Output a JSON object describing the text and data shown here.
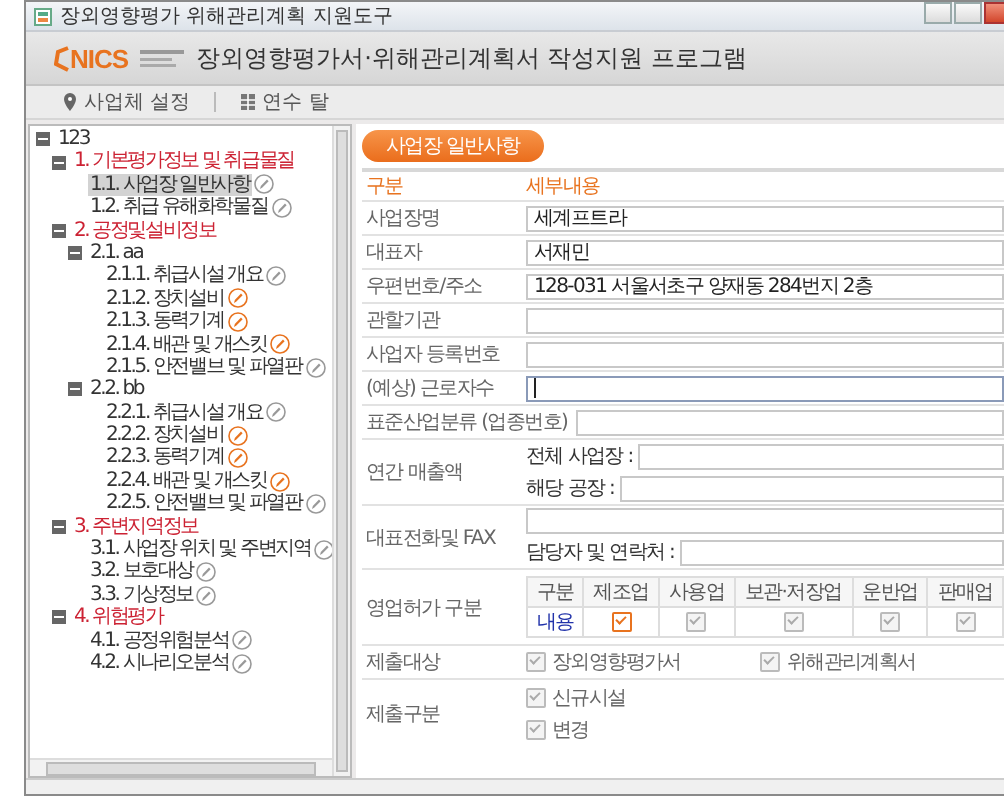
{
  "window": {
    "title": "장외영향평가 위해관리계획 지원도구"
  },
  "header": {
    "logo": "NICS",
    "title": "장외영향평가서·위해관리계획서 작성지원 프로그램"
  },
  "toolbar": [
    {
      "label": "사업체 설정"
    },
    {
      "label": "연수 탈"
    }
  ],
  "tree": {
    "label": "123",
    "expanded": true,
    "children": [
      {
        "label": "1. 기본평가정보 및 취급물질",
        "expanded": true,
        "children": [
          {
            "label": "1.1. 사업장 일반사항",
            "selected": true,
            "flagged": false
          },
          {
            "label": "1.2. 취급 유해화학물질",
            "selected": false,
            "flagged": false
          }
        ]
      },
      {
        "label": "2. 공정및설비정보",
        "expanded": true,
        "children": [
          {
            "label": "2.1. aa",
            "expanded": true,
            "children": [
              {
                "label": "2.1.1. 취급시설 개요",
                "selected": false,
                "flagged": false
              },
              {
                "label": "2.1.2. 장치설비",
                "selected": false,
                "flagged": true
              },
              {
                "label": "2.1.3. 동력기계",
                "selected": false,
                "flagged": true
              },
              {
                "label": "2.1.4. 배관 및 개스킷",
                "selected": false,
                "flagged": true
              },
              {
                "label": "2.1.5. 안전밸브 및 파열판",
                "selected": false,
                "flagged": false
              }
            ]
          },
          {
            "label": "2.2. bb",
            "expanded": true,
            "children": [
              {
                "label": "2.2.1. 취급시설 개요",
                "selected": false,
                "flagged": false
              },
              {
                "label": "2.2.2. 장치설비",
                "selected": false,
                "flagged": true
              },
              {
                "label": "2.2.3. 동력기계",
                "selected": false,
                "flagged": true
              },
              {
                "label": "2.2.4. 배관 및 개스킷",
                "selected": false,
                "flagged": true
              },
              {
                "label": "2.2.5. 안전밸브 및 파열판",
                "selected": false,
                "flagged": false
              }
            ]
          }
        ]
      },
      {
        "label": "3. 주변지역정보",
        "expanded": true,
        "children": [
          {
            "label": "3.1. 사업장 위치 및 주변지역",
            "selected": false,
            "flagged": false
          },
          {
            "label": "3.2. 보호대상",
            "selected": false,
            "flagged": false
          },
          {
            "label": "3.3. 기상정보",
            "selected": false,
            "flagged": false
          }
        ]
      },
      {
        "label": "4. 위험평가",
        "expanded": true,
        "children": [
          {
            "label": "4.1. 공정위험분석",
            "selected": false,
            "flagged": false
          },
          {
            "label": "4.2. 시나리오분석",
            "selected": false,
            "flagged": false
          }
        ]
      }
    ]
  },
  "form": {
    "section_button": "사업장 일반사항",
    "columns": [
      "구분",
      "세부내용"
    ],
    "rows": [
      {
        "kind": "text",
        "label": "사업장명",
        "value": "세계프트라",
        "focused": false
      },
      {
        "kind": "text",
        "label": "대표자",
        "value": "서재민",
        "focused": false
      },
      {
        "kind": "text",
        "label": "우편번호/주소",
        "value": "128-031 서울서초구 양재동 284번지 2층",
        "focused": false
      },
      {
        "kind": "text",
        "label": "관할기관",
        "focused": false
      },
      {
        "kind": "text",
        "label": "사업자 등록번호",
        "focused": false
      },
      {
        "kind": "text",
        "label": "(예상) 근로자수",
        "focused": true
      },
      {
        "kind": "text",
        "label": "표준산업분류 (업종번호)",
        "focused": false
      },
      {
        "kind": "sub",
        "label": "연간 매출액",
        "blank_first": false,
        "fields": [
          {
            "label": "전체 사업장 :"
          },
          {
            "label": "해당 공장 :"
          }
        ]
      },
      {
        "kind": "sub",
        "label": "대표전화및 FAX",
        "blank_first": true,
        "fields": [
          {
            "label": "담당자 및 연락처 :"
          }
        ]
      },
      {
        "kind": "grid",
        "label": "영업허가 구분",
        "columns": [
          "구분",
          "제조업",
          "사용업",
          "보관·저장업",
          "운반업",
          "판매업"
        ],
        "row_label": "내용",
        "checks": [
          {
            "checked": true,
            "disabled": false
          },
          {
            "checked": true,
            "disabled": true
          },
          {
            "checked": true,
            "disabled": true
          },
          {
            "checked": true,
            "disabled": true
          },
          {
            "checked": true,
            "disabled": true
          }
        ]
      },
      {
        "kind": "checks-row",
        "label": "제출대상",
        "options": [
          {
            "label": "장외영향평가서",
            "checked": true
          },
          {
            "label": "위해관리계획서",
            "checked": true
          }
        ]
      },
      {
        "kind": "checks-column",
        "label": "제출구분",
        "options": [
          {
            "label": "신규시설",
            "checked": true
          },
          {
            "label": "변경",
            "checked": true
          }
        ]
      }
    ]
  }
}
